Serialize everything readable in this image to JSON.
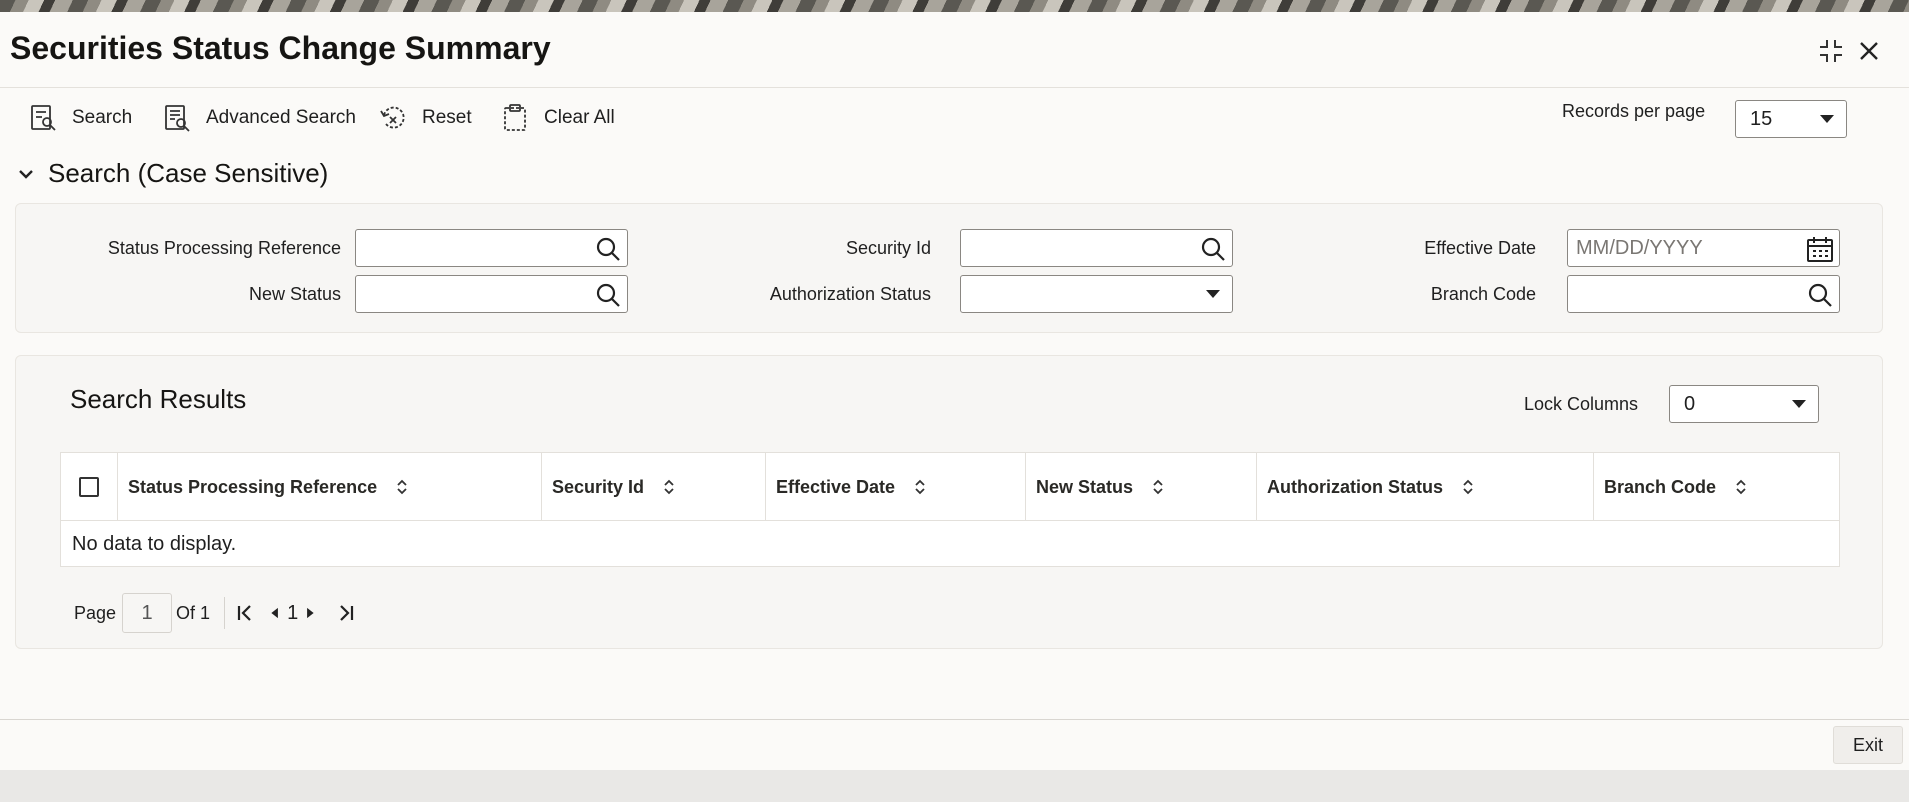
{
  "window": {
    "title": "Securities Status Change Summary",
    "controls": {
      "maximize_icon": "collapse-arrows-icon",
      "close_icon": "close-icon"
    }
  },
  "toolbar": {
    "search_label": "Search",
    "advanced_search_label": "Advanced Search",
    "reset_label": "Reset",
    "clear_all_label": "Clear All",
    "records_per_page_label": "Records per page",
    "records_per_page_value": "15"
  },
  "search_section": {
    "title": "Search (Case Sensitive)",
    "fields": {
      "status_processing_reference": {
        "label": "Status Processing Reference",
        "value": ""
      },
      "security_id": {
        "label": "Security Id",
        "value": ""
      },
      "effective_date": {
        "label": "Effective Date",
        "value": "",
        "placeholder": "MM/DD/YYYY"
      },
      "new_status": {
        "label": "New Status",
        "value": ""
      },
      "authorization_status": {
        "label": "Authorization Status",
        "value": ""
      },
      "branch_code": {
        "label": "Branch Code",
        "value": ""
      }
    }
  },
  "results": {
    "title": "Search Results",
    "lock_columns_label": "Lock Columns",
    "lock_columns_value": "0",
    "columns": [
      "Status Processing Reference",
      "Security Id",
      "Effective Date",
      "New Status",
      "Authorization Status",
      "Branch Code"
    ],
    "rows": [],
    "empty_message": "No data to display.",
    "pagination": {
      "page_label": "Page",
      "current_page": "1",
      "of_label": "Of 1",
      "page_indicator": "1"
    }
  },
  "footer": {
    "exit_label": "Exit"
  },
  "colors": {
    "accent": "#161513",
    "panel": "#f7f6f4",
    "border": "#8a8782"
  }
}
